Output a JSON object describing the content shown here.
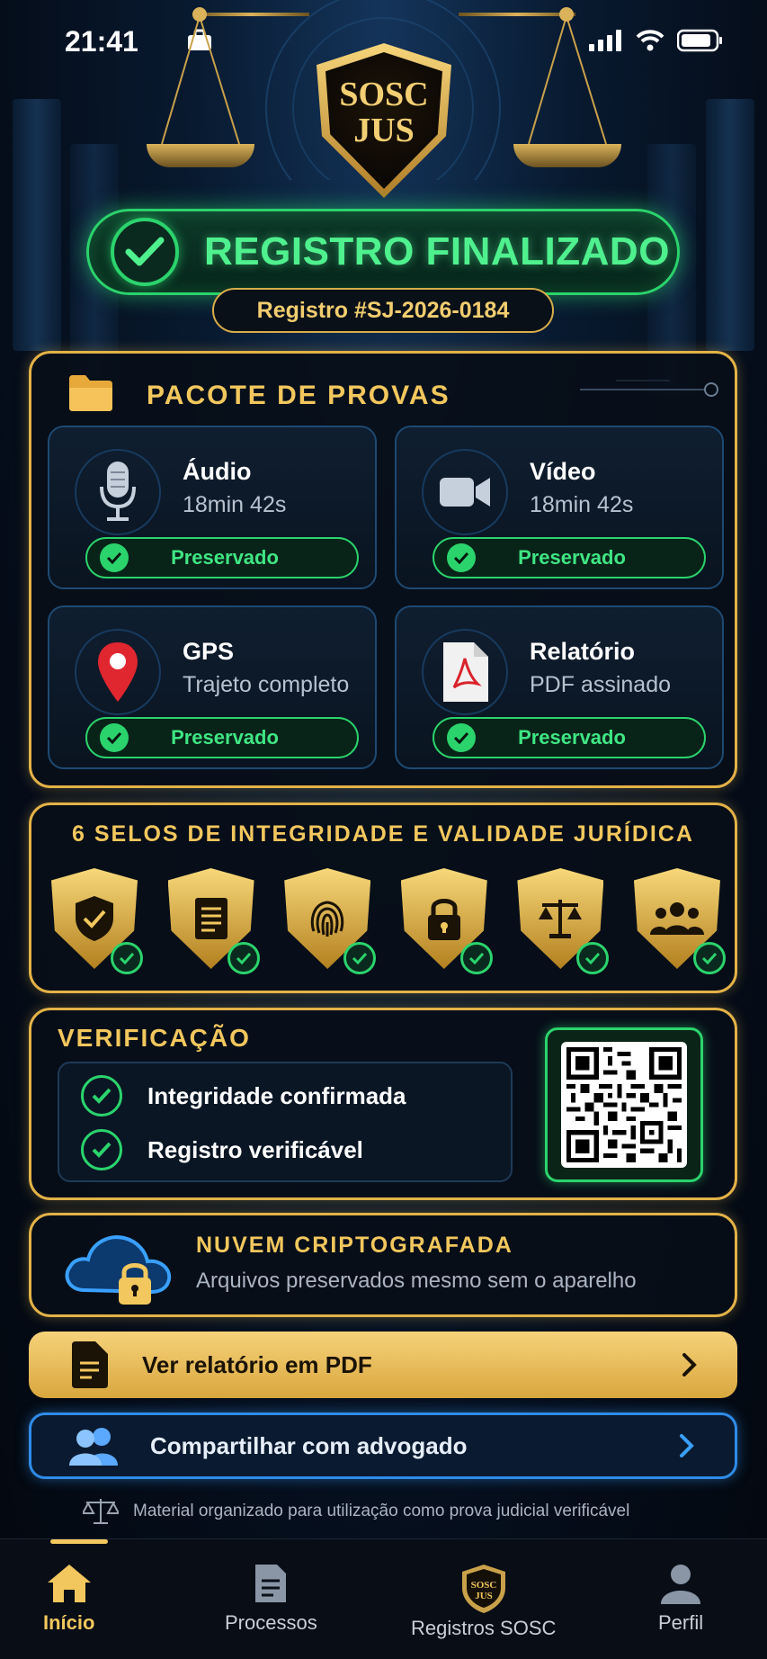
{
  "status_bar": {
    "time": "21:41"
  },
  "logo": {
    "line1": "SOSC",
    "line2": "JUS"
  },
  "banner": {
    "title": "REGISTRO FINALIZADO",
    "registro": "Registro #SJ-2026-0184"
  },
  "evidence": {
    "title": "PACOTE DE PROVAS",
    "items": [
      {
        "title": "Áudio",
        "subtitle": "18min 42s",
        "status": "Preservado",
        "icon": "microphone-icon"
      },
      {
        "title": "Vídeo",
        "subtitle": "18min 42s",
        "status": "Preservado",
        "icon": "video-camera-icon"
      },
      {
        "title": "GPS",
        "subtitle": "Trajeto completo",
        "status": "Preservado",
        "icon": "location-pin-icon"
      },
      {
        "title": "Relatório",
        "subtitle": "PDF assinado",
        "status": "Preservado",
        "icon": "pdf-file-icon"
      }
    ]
  },
  "seals": {
    "title": "6 SELOS DE INTEGRIDADE E VALIDADE JURÍDICA",
    "items": [
      "shield-check-icon",
      "document-icon",
      "fingerprint-icon",
      "lock-icon",
      "scales-icon",
      "group-icon"
    ]
  },
  "verification": {
    "title": "VERIFICAÇÃO",
    "items": [
      "Integridade confirmada",
      "Registro verificável"
    ]
  },
  "cloud": {
    "title": "NUVEM CRIPTOGRAFADA",
    "subtitle": "Arquivos preservados mesmo sem o aparelho"
  },
  "actions": {
    "pdf_label": "Ver relatório em PDF",
    "share_label": "Compartilhar com advogado"
  },
  "footer_note": "Material organizado para utilização como prova judicial verificável",
  "tabbar": {
    "items": [
      {
        "label": "Início",
        "icon": "home-icon",
        "active": true
      },
      {
        "label": "Processos",
        "icon": "document-icon"
      },
      {
        "label": "Registros SOSC",
        "icon": "sosc-badge-icon"
      },
      {
        "label": "Perfil",
        "icon": "profile-icon"
      }
    ]
  },
  "colors": {
    "gold": "#e3b247",
    "green": "#2bd36c",
    "blue": "#2f8ce8"
  }
}
